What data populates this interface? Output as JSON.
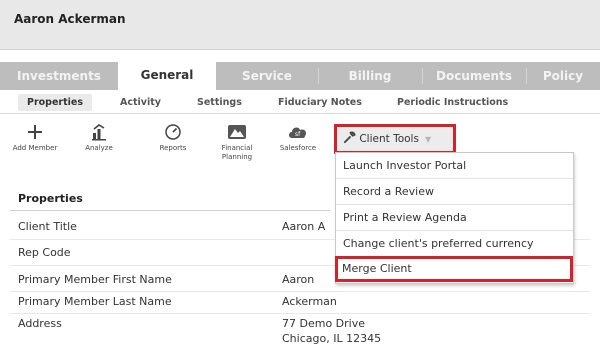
{
  "header": {
    "client_name": "Aaron Ackerman"
  },
  "tabs": [
    {
      "label": "Investments",
      "active": false
    },
    {
      "label": "General",
      "active": true
    },
    {
      "label": "Service",
      "active": false
    },
    {
      "label": "Billing",
      "active": false
    },
    {
      "label": "Documents",
      "active": false
    },
    {
      "label": "Policy",
      "active": false
    }
  ],
  "subtabs": [
    {
      "label": "Properties",
      "active": true
    },
    {
      "label": "Activity",
      "active": false
    },
    {
      "label": "Settings",
      "active": false
    },
    {
      "label": "Fiduciary Notes",
      "active": false
    },
    {
      "label": "Periodic Instructions",
      "active": false
    }
  ],
  "toolbar": {
    "add_member": "Add Member",
    "analyze": "Analyze",
    "reports": "Reports",
    "financial_planning": "Financial Planning",
    "salesforce": "Salesforce",
    "client_tools": "Client Tools"
  },
  "properties": {
    "title": "Properties",
    "rows": [
      {
        "label": "Client Title",
        "value": "Aaron A"
      },
      {
        "label": "Rep Code",
        "value": ""
      },
      {
        "label": "Primary Member First Name",
        "value": "Aaron"
      },
      {
        "label": "Primary Member Last Name",
        "value": "Ackerman"
      },
      {
        "label": "Address",
        "value": "77 Demo Drive",
        "value2": "Chicago, IL 12345"
      }
    ]
  },
  "menu": {
    "items": [
      "Launch Investor Portal",
      "Record a Review",
      "Print a Review Agenda",
      "Change client's preferred currency",
      "Merge Client"
    ]
  },
  "colors": {
    "highlight": "#d2232a",
    "tab_strip": "#bdbdbd",
    "header_bg": "#e8e8e8"
  }
}
